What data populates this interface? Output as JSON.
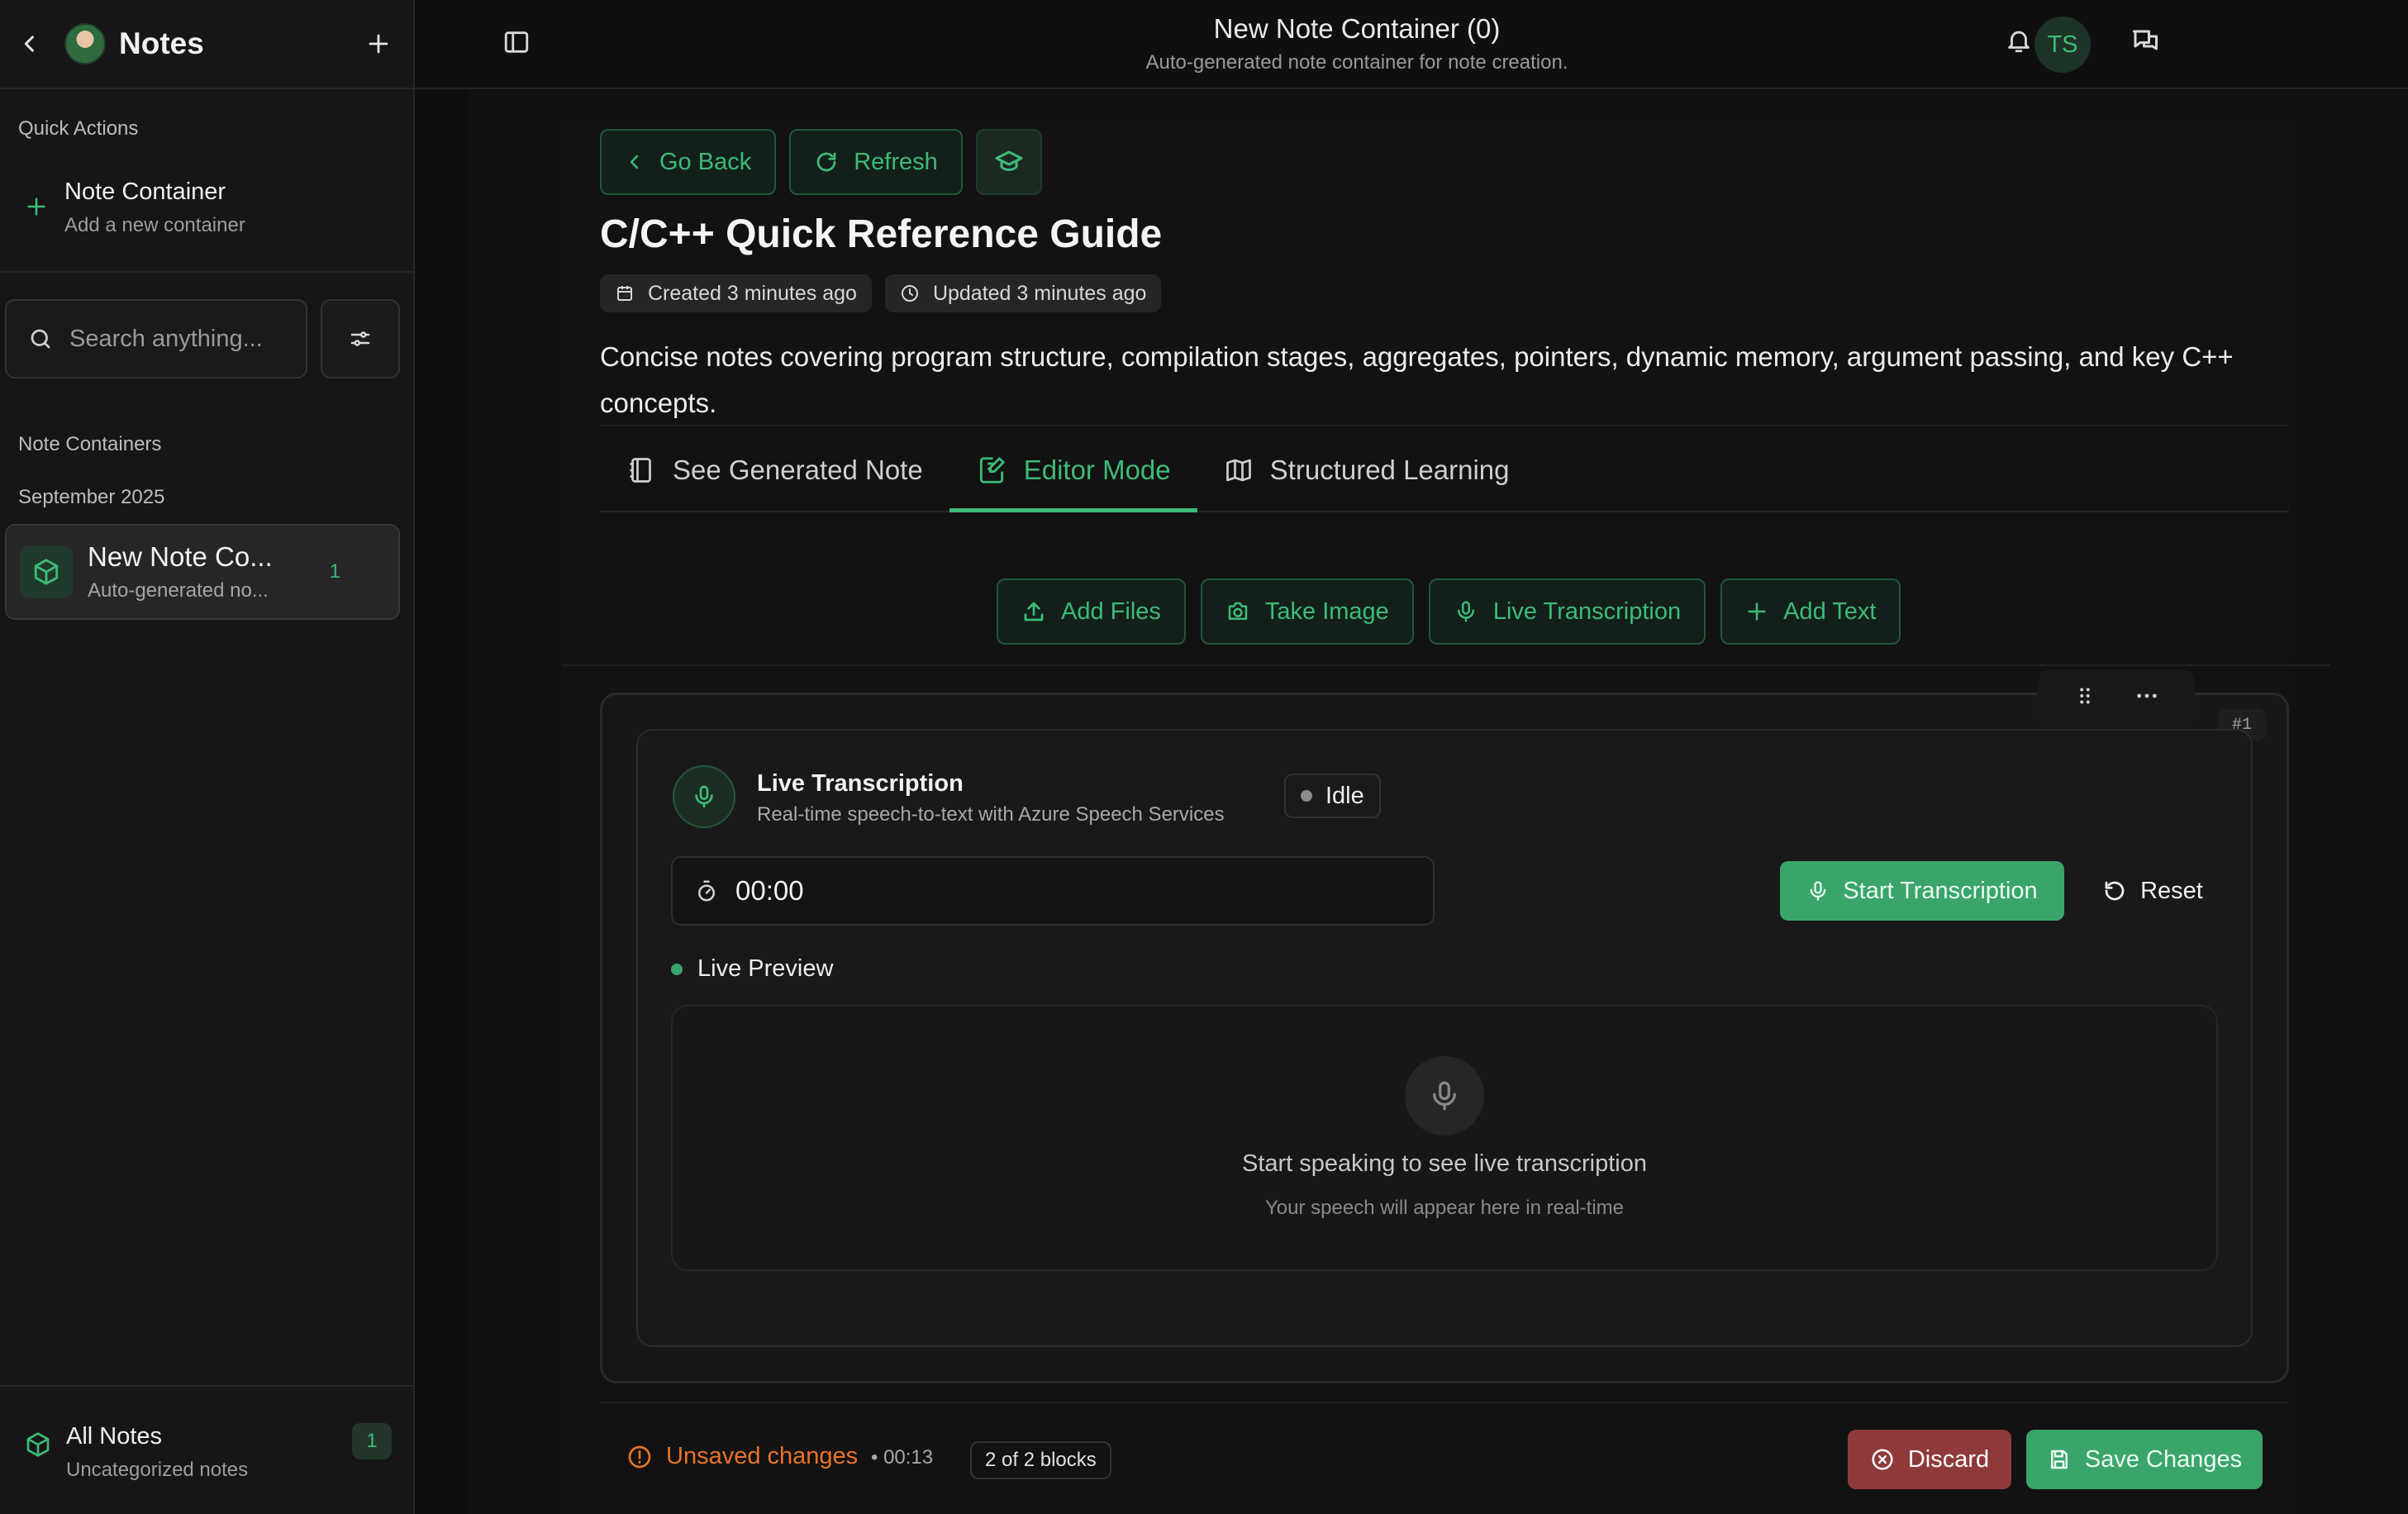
{
  "colors": {
    "accent": "#3dbb78",
    "accent_solid": "#3aa56b",
    "warning": "#e8742a",
    "danger": "#8f3a3a",
    "background": "#0e0e0e",
    "sidebar": "#161616"
  },
  "sidebar": {
    "title": "Notes",
    "quick_actions_label": "Quick Actions",
    "quick_action": {
      "title": "Note Container",
      "subtitle": "Add a new container"
    },
    "search": {
      "placeholder": "Search anything..."
    },
    "containers_label": "Note Containers",
    "month_label": "September 2025",
    "containers": [
      {
        "title": "New Note Co...",
        "subtitle": "Auto-generated no...",
        "count": "1",
        "icon": "cube-icon"
      }
    ],
    "all_notes": {
      "title": "All Notes",
      "subtitle": "Uncategorized notes",
      "count": "1"
    }
  },
  "topbar": {
    "title": "New Note Container (0)",
    "subtitle": "Auto-generated note container for note creation.",
    "user_initials": "TS"
  },
  "toolbar": {
    "go_back": "Go Back",
    "refresh": "Refresh",
    "learn_icon": "graduation-cap-icon"
  },
  "document": {
    "title": "C/C++ Quick Reference Guide",
    "created": "Created 3 minutes ago",
    "updated": "Updated 3 minutes ago",
    "description": "Concise notes covering program structure, compilation stages, aggregates, pointers, dynamic memory, argument passing, and key C++ concepts."
  },
  "tabs": [
    {
      "label": "See Generated Note",
      "icon": "notebook-icon",
      "active": false
    },
    {
      "label": "Editor Mode",
      "icon": "edit-icon",
      "active": true
    },
    {
      "label": "Structured Learning",
      "icon": "map-icon",
      "active": false
    }
  ],
  "add_actions": {
    "add_files": "Add Files",
    "take_image": "Take Image",
    "live_transcription": "Live Transcription",
    "add_text": "Add Text"
  },
  "block": {
    "number": "#1",
    "title": "Live Transcription",
    "subtitle": "Real-time speech-to-text with Azure Speech Services",
    "status": "Idle",
    "timer": "00:00",
    "start_label": "Start Transcription",
    "reset_label": "Reset",
    "preview_label": "Live Preview",
    "preview_title": "Start speaking to see live transcription",
    "preview_sub": "Your speech will appear here in real-time"
  },
  "footer": {
    "unsaved": "Unsaved changes",
    "time": "• 00:13",
    "blocks": "2 of 2 blocks",
    "discard": "Discard",
    "save": "Save Changes"
  }
}
